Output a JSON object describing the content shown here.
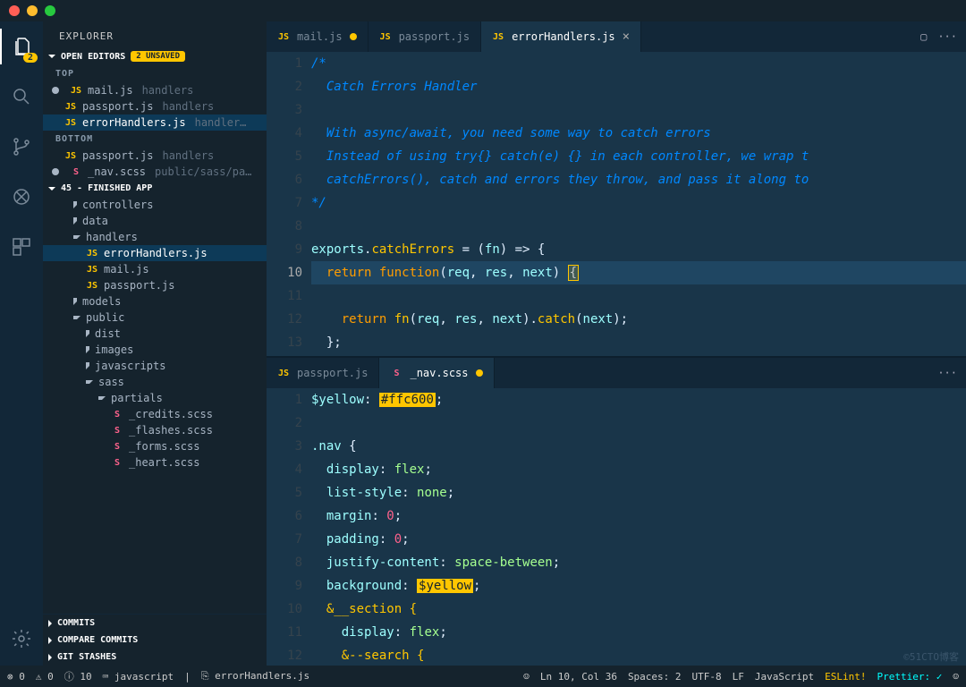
{
  "explorer": {
    "title": "EXPLORER",
    "open_editors": {
      "label": "OPEN EDITORS",
      "badge": "2 UNSAVED"
    },
    "groups": {
      "top": "TOP",
      "bottom": "BOTTOM"
    },
    "top_items": [
      {
        "icon": "JS",
        "name": "mail.js",
        "dim": "handlers",
        "dirty": true
      },
      {
        "icon": "JS",
        "name": "passport.js",
        "dim": "handlers"
      },
      {
        "icon": "JS",
        "name": "errorHandlers.js",
        "dim": "handler…"
      }
    ],
    "bottom_items": [
      {
        "icon": "JS",
        "name": "passport.js",
        "dim": "handlers"
      },
      {
        "icon": "S",
        "name": "_nav.scss",
        "dim": "public/sass/pa…",
        "scss": true,
        "dirty": true
      }
    ],
    "project": "45 - FINISHED APP",
    "tree": [
      {
        "t": "folder",
        "name": "controllers",
        "l": 1
      },
      {
        "t": "folder",
        "name": "data",
        "l": 1
      },
      {
        "t": "folder",
        "name": "handlers",
        "l": 1,
        "open": true
      },
      {
        "t": "file",
        "icon": "JS",
        "name": "errorHandlers.js",
        "l": 2,
        "active": true
      },
      {
        "t": "file",
        "icon": "JS",
        "name": "mail.js",
        "l": 2
      },
      {
        "t": "file",
        "icon": "JS",
        "name": "passport.js",
        "l": 2
      },
      {
        "t": "folder",
        "name": "models",
        "l": 1
      },
      {
        "t": "folder",
        "name": "public",
        "l": 1,
        "open": true
      },
      {
        "t": "folder",
        "name": "dist",
        "l": 2
      },
      {
        "t": "folder",
        "name": "images",
        "l": 2
      },
      {
        "t": "folder",
        "name": "javascripts",
        "l": 2
      },
      {
        "t": "folder",
        "name": "sass",
        "l": 2,
        "open": true
      },
      {
        "t": "folder",
        "name": "partials",
        "l": 3,
        "open": true
      },
      {
        "t": "file",
        "icon": "S",
        "name": "_credits.scss",
        "l": 4,
        "scss": true
      },
      {
        "t": "file",
        "icon": "S",
        "name": "_flashes.scss",
        "l": 4,
        "scss": true
      },
      {
        "t": "file",
        "icon": "S",
        "name": "_forms.scss",
        "l": 4,
        "scss": true
      },
      {
        "t": "file",
        "icon": "S",
        "name": "_heart.scss",
        "l": 4,
        "scss": true
      }
    ],
    "collapsed": [
      "COMMITS",
      "COMPARE COMMITS",
      "GIT STASHES"
    ]
  },
  "editor_top": {
    "tabs": [
      {
        "icon": "JS",
        "label": "mail.js",
        "dirty": true
      },
      {
        "icon": "JS",
        "label": "passport.js"
      },
      {
        "icon": "JS",
        "label": "errorHandlers.js",
        "active": true,
        "close": true
      }
    ],
    "start_line": 1,
    "lines": [
      "/*",
      "  Catch Errors Handler",
      "",
      "  With async/await, you need some way to catch errors",
      "  Instead of using try{} catch(e) {} in each controller, we wrap t",
      "  catchErrors(), catch and errors they throw, and pass it along to ",
      "*/"
    ],
    "code_tail": [
      "",
      "exports.catchErrors = (fn) => {",
      "  return function(req, res, next) {",
      "    return fn(req, res, next).catch(next);",
      "  };",
      "};"
    ],
    "highlight_line": 10
  },
  "editor_bottom": {
    "tabs": [
      {
        "icon": "JS",
        "label": "passport.js"
      },
      {
        "icon": "S",
        "label": "_nav.scss",
        "scss": true,
        "active": true,
        "dirty": true
      }
    ],
    "start_line": 1,
    "scss": {
      "var": "$yellow",
      "color": "#ffc600",
      "sel": ".nav",
      "rules": [
        [
          "display",
          "flex"
        ],
        [
          "list-style",
          "none"
        ],
        [
          "margin",
          "0"
        ],
        [
          "padding",
          "0"
        ],
        [
          "justify-content",
          "space-between"
        ],
        [
          "background",
          "$yellow"
        ]
      ],
      "nest1": "&__section {",
      "nest1_rule": [
        "display",
        "flex"
      ],
      "nest2": "&--search {"
    }
  },
  "status": {
    "errors": "0",
    "warn": "0",
    "info": "10",
    "lang_btn": "javascript",
    "path": "errorHandlers.js",
    "pos": "Ln 10, Col 36",
    "spaces": "Spaces: 2",
    "enc": "UTF-8",
    "eol": "LF",
    "mode": "JavaScript",
    "eslint": "ESLint!",
    "pret": "Prettier: ✓"
  },
  "activity_badge": "2",
  "watermark": "©51CTO博客"
}
